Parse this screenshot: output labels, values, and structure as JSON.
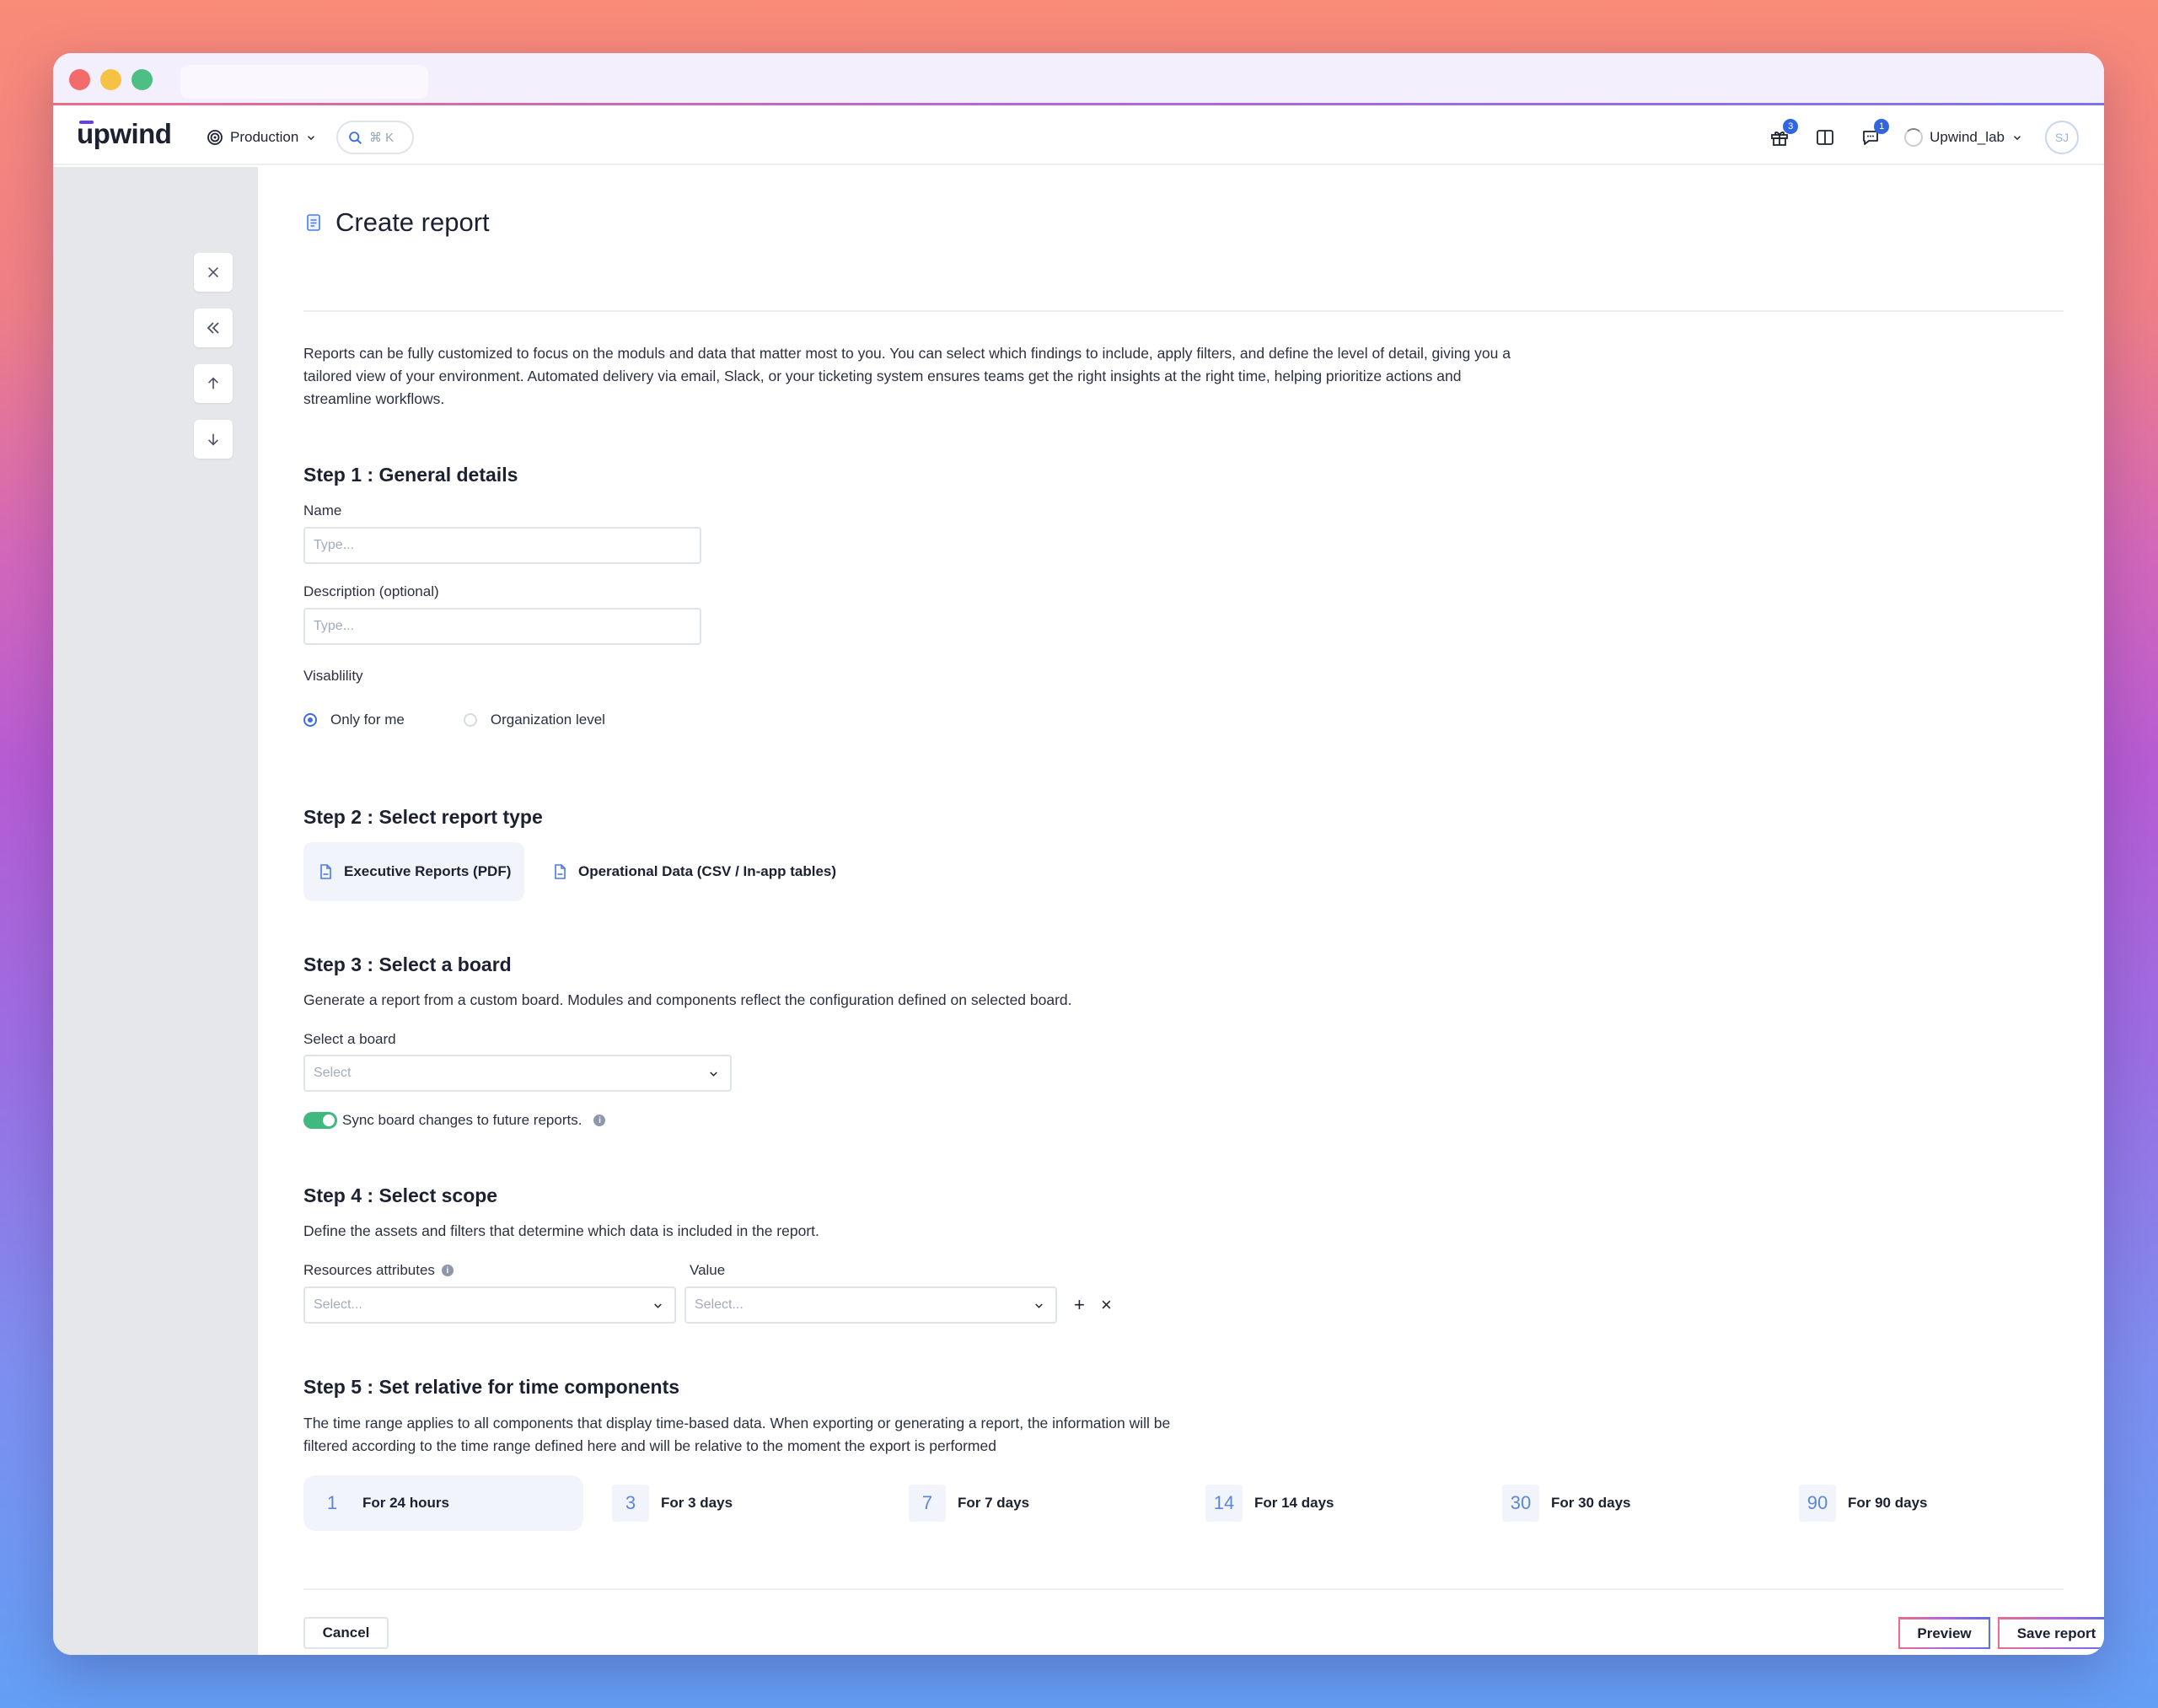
{
  "header": {
    "logo": "upwind",
    "environment": "Production",
    "search_shortcut": "⌘ K",
    "gift_badge": "3",
    "chat_badge": "1",
    "org_name": "Upwind_lab",
    "avatar_initials": "SJ"
  },
  "page": {
    "title": "Create report",
    "intro": "Reports can be fully customized to focus on the moduls and data that matter most to you. You can select which findings to include, apply filters, and define the level of detail, giving you a tailored view of your environment. Automated delivery via email, Slack, or your ticketing system ensures teams get the right insights at the right time, helping prioritize actions and streamline workflows."
  },
  "step1": {
    "title": "Step 1 : General details",
    "name_label": "Name",
    "name_value": "",
    "name_placeholder": "Type...",
    "description_label": "Description (optional)",
    "description_value": "",
    "description_placeholder": "Type...",
    "visibility_label": "Visablility",
    "visibility_options": [
      {
        "label": "Only for me",
        "selected": true
      },
      {
        "label": "Organization level",
        "selected": false
      }
    ]
  },
  "step2": {
    "title": "Step 2 : Select report type",
    "options": [
      {
        "label": "Executive Reports (PDF)",
        "selected": true
      },
      {
        "label": "Operational Data (CSV / In-app tables)",
        "selected": false
      }
    ]
  },
  "step3": {
    "title": "Step 3 : Select a board",
    "description": "Generate a report from a custom board. Modules and components reflect the configuration defined on selected board.",
    "board_label": "Select a board",
    "board_placeholder": "Select",
    "sync_label": "Sync board changes to future reports.",
    "sync_enabled": true
  },
  "step4": {
    "title": "Step 4 : Select scope",
    "description": "Define the assets and filters that determine which data is included in the report.",
    "attributes_label": "Resources attributes",
    "attributes_placeholder": "Select...",
    "value_label": "Value",
    "value_placeholder": "Select...",
    "add_symbol": "+",
    "remove_symbol": "×"
  },
  "step5": {
    "title": "Step 5 : Set relative for time components",
    "description_line1": "The time range applies to all components that display time-based data. When exporting or generating a report, the information will be",
    "description_line2": "filtered according to the time range defined here and will be relative to the moment the export is performed",
    "options": [
      {
        "num": "1",
        "label": "For 24 hours",
        "selected": true
      },
      {
        "num": "3",
        "label": "For 3 days",
        "selected": false
      },
      {
        "num": "7",
        "label": "For 7 days",
        "selected": false
      },
      {
        "num": "14",
        "label": "For 14 days",
        "selected": false
      },
      {
        "num": "30",
        "label": "For 30 days",
        "selected": false
      },
      {
        "num": "90",
        "label": "For 90 days",
        "selected": false
      }
    ]
  },
  "footer": {
    "cancel_label": "Cancel",
    "preview_label": "Preview",
    "save_label": "Save report"
  },
  "colors": {
    "accent_blue": "#3d6ee6",
    "toggle_green": "#3fb97e",
    "brand_purple": "#6a3fe6"
  }
}
